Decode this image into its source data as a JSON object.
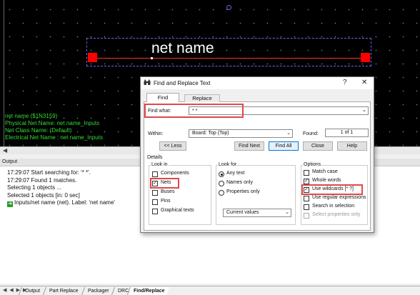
{
  "canvas": {
    "net_label": "net name",
    "info_lines": [
      "net name ($1N3159)",
      "Physical Net Name: net name_Inputs",
      "Net Class Name: (Default)",
      "Electrical Net Name : net name_Inputs"
    ],
    "scroll_left_icon": "◀"
  },
  "output": {
    "header": "Output",
    "lines": [
      "17:29:07 Start searching for: '* *'.",
      "17:29:07 Found 1 matches.",
      "Selecting 1 objects ...",
      "Selected 1 objects [in: 0 sec]"
    ],
    "result_line": "Inputs/net name (net). Label: 'net name'",
    "result_icon": "arrow-right-icon",
    "tab_nav": "◀ ◀ ▶ ▶",
    "tabs": [
      "Output",
      "Part Replace",
      "Packager",
      "DRC",
      "Find/Replace"
    ],
    "active_tab": "Find/Replace"
  },
  "dialog": {
    "title": "Find and Replace Text",
    "title_icon": "binoculars-icon",
    "help_glyph": "?",
    "close_glyph": "✕",
    "tabs": {
      "find": "Find",
      "replace": "Replace"
    },
    "find_what_label": "Find what:",
    "find_what_value": "* *",
    "within_label": "Within:",
    "within_value": "Board: Top (Top)",
    "found_label": "Found:",
    "found_value": "1 of 1",
    "buttons": {
      "less": "<< Less",
      "find_next": "Find Next",
      "find_all": "Find All",
      "close": "Close",
      "help": "Help"
    },
    "details_label": "Details",
    "look_in": {
      "title": "Look in",
      "items": [
        {
          "label": "Components",
          "checked": false
        },
        {
          "label": "Nets",
          "checked": true
        },
        {
          "label": "Buses",
          "checked": false
        },
        {
          "label": "Pins",
          "checked": false
        },
        {
          "label": "Graphical texts",
          "checked": false
        }
      ]
    },
    "look_for": {
      "title": "Look for",
      "items": [
        {
          "label": "Any text",
          "selected": true
        },
        {
          "label": "Names only",
          "selected": false
        },
        {
          "label": "Properties only",
          "selected": false
        }
      ],
      "values_select": "Current values"
    },
    "options": {
      "title": "Options",
      "items": [
        {
          "label": "Match case",
          "checked": false,
          "disabled": false
        },
        {
          "label": "Whole words",
          "checked": true,
          "disabled": false
        },
        {
          "label": "Use wildcards [* ?]",
          "checked": true,
          "disabled": false
        },
        {
          "label": "Use regular expressions",
          "checked": false,
          "disabled": false
        },
        {
          "label": "Search in selection",
          "checked": false,
          "disabled": false
        },
        {
          "label": "Select properties only",
          "checked": false,
          "disabled": true
        }
      ]
    },
    "check_mark": "✓",
    "dropdown_glyph": "⌄"
  }
}
